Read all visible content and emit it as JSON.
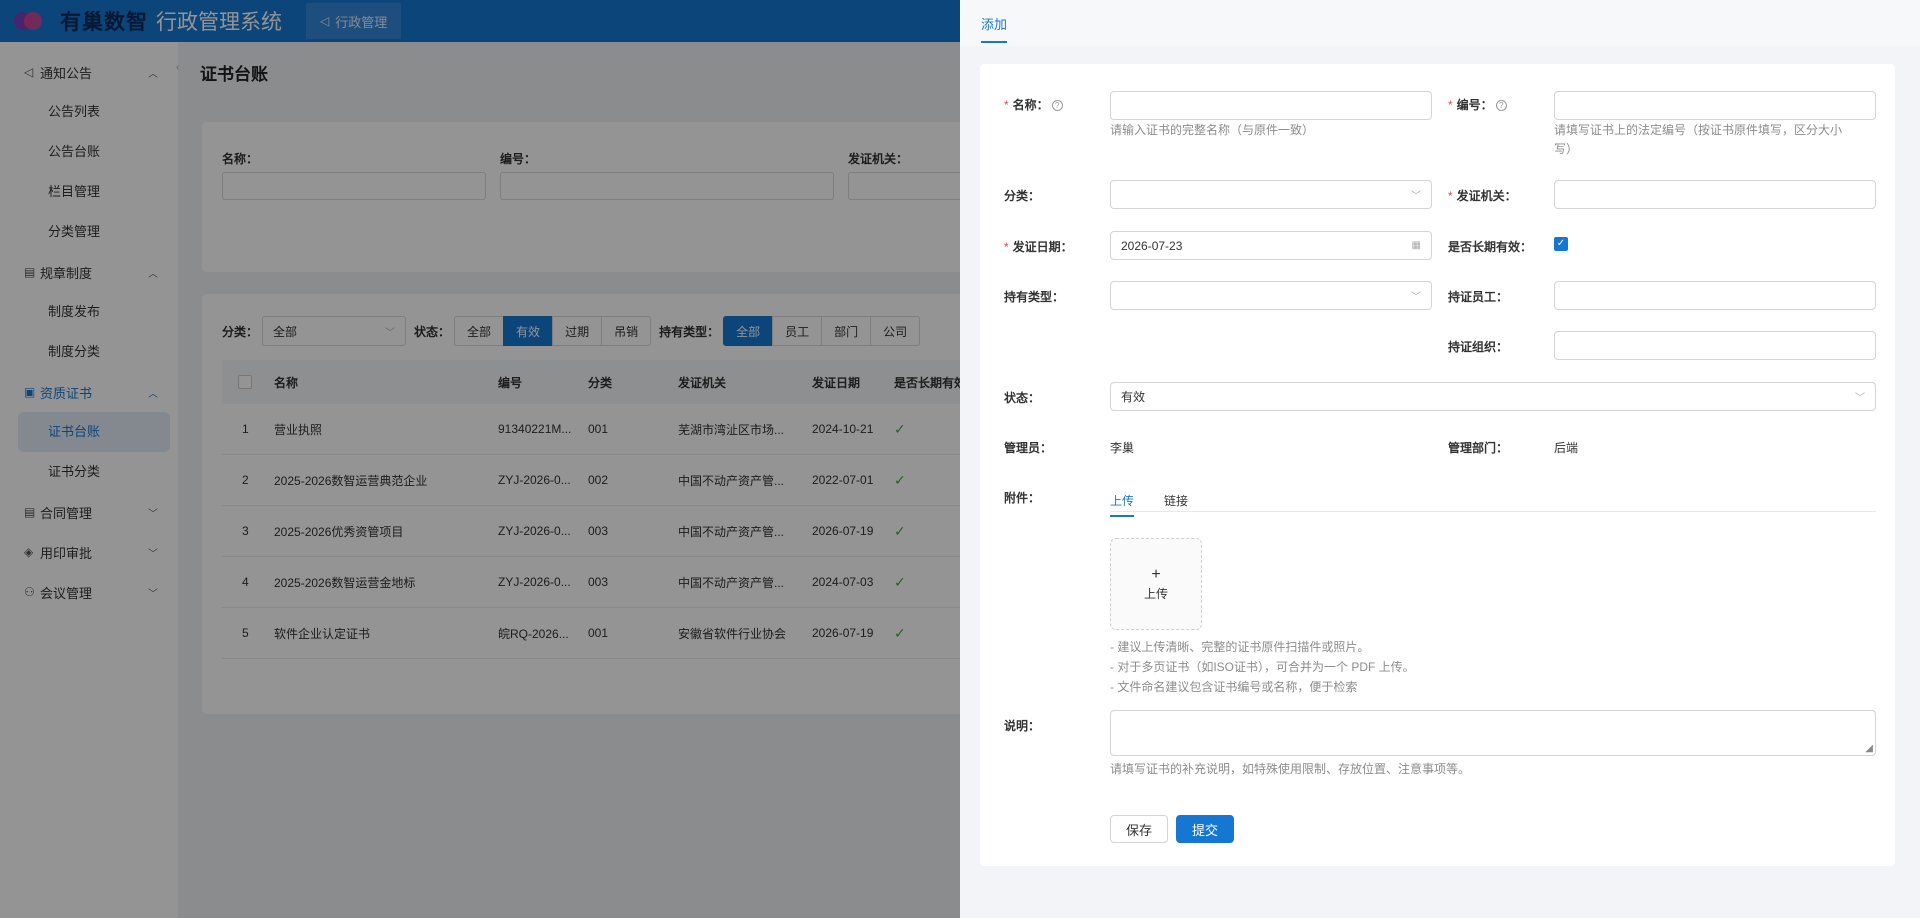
{
  "app": {
    "logo_text": "有巢数智",
    "system_title": "行政管理系统",
    "top_tab": "行政管理"
  },
  "sidebar": {
    "groups": [
      {
        "label": "通知公告",
        "icon": "megaphone-icon",
        "items": [
          "公告列表",
          "公告台账",
          "栏目管理",
          "分类管理"
        ]
      },
      {
        "label": "规章制度",
        "icon": "document-icon",
        "items": [
          "制度发布",
          "制度分类"
        ]
      },
      {
        "label": "资质证书",
        "icon": "certificate-icon",
        "items": [
          "证书台账",
          "证书分类"
        ]
      },
      {
        "label": "合同管理",
        "icon": "contract-icon",
        "items": []
      },
      {
        "label": "用印审批",
        "icon": "seal-icon",
        "items": []
      },
      {
        "label": "会议管理",
        "icon": "people-icon",
        "items": []
      }
    ],
    "active_item": "证书台账"
  },
  "page": {
    "title": "证书台账",
    "filters": {
      "name_label": "名称：",
      "code_label": "编号：",
      "issuer_label": "发证机关："
    },
    "toolbar": {
      "category_label": "分类：",
      "category_value": "全部",
      "status_label": "状态：",
      "status_options": [
        "全部",
        "有效",
        "过期",
        "吊销"
      ],
      "status_selected": "有效",
      "holder_label": "持有类型：",
      "holder_options": [
        "全部",
        "员工",
        "部门",
        "公司"
      ],
      "holder_selected": "全部"
    },
    "table": {
      "columns": [
        "名称",
        "编号",
        "分类",
        "发证机关",
        "发证日期",
        "是否长期有效"
      ],
      "rows": [
        {
          "idx": "1",
          "name": "营业执照",
          "code": "91340221M...",
          "cat": "001",
          "issuer": "芜湖市湾沚区市场...",
          "date": "2024-10-21",
          "longterm": "✓"
        },
        {
          "idx": "2",
          "name": "2025-2026数智运营典范企业",
          "code": "ZYJ-2026-0...",
          "cat": "002",
          "issuer": "中国不动产资产管...",
          "date": "2022-07-01",
          "longterm": "✓"
        },
        {
          "idx": "3",
          "name": "2025-2026优秀资管项目",
          "code": "ZYJ-2026-0...",
          "cat": "003",
          "issuer": "中国不动产资产管...",
          "date": "2026-07-19",
          "longterm": "✓"
        },
        {
          "idx": "4",
          "name": "2025-2026数智运营金地标",
          "code": "ZYJ-2026-0...",
          "cat": "003",
          "issuer": "中国不动产资产管...",
          "date": "2024-07-03",
          "longterm": "✓"
        },
        {
          "idx": "5",
          "name": "软件企业认定证书",
          "code": "皖RQ-2026...",
          "cat": "001",
          "issuer": "安徽省软件行业协会",
          "date": "2026-07-19",
          "longterm": "✓"
        }
      ]
    }
  },
  "drawer": {
    "tab": "添加",
    "form": {
      "name_label": "名称：",
      "name_hint": "请输入证书的完整名称（与原件一致）",
      "code_label": "编号：",
      "code_hint_1": "请填写证书上的法定编号（按证书原件填写，区分大小",
      "code_hint_2": "写）",
      "category_label": "分类：",
      "issuer_label": "发证机关：",
      "issue_date_label": "发证日期：",
      "issue_date_value": "2026-07-23",
      "longterm_label": "是否长期有效：",
      "longterm_checked": true,
      "holder_type_label": "持有类型：",
      "holder_employee_label": "持证员工：",
      "holder_org_label": "持证组织：",
      "status_label": "状态：",
      "status_value": "有效",
      "admin_label": "管理员：",
      "admin_value": "李巢",
      "admin_dept_label": "管理部门：",
      "admin_dept_value": "后端",
      "attachment_label": "附件：",
      "attachment_tabs": [
        "上传",
        "链接"
      ],
      "upload_label": "上传",
      "upload_tips": [
        "- 建议上传清晰、完整的证书原件扫描件或照片。",
        "- 对于多页证书（如ISO证书），可合并为一个 PDF 上传。",
        "- 文件命名建议包含证书编号或名称，便于检索"
      ],
      "description_label": "说明：",
      "description_hint": "请填写证书的补充说明，如特殊使用限制、存放位置、注意事项等。",
      "save_label": "保存",
      "submit_label": "提交"
    }
  },
  "colors": {
    "primary": "#1677d2",
    "required": "#e54545",
    "check": "#3caa3c"
  }
}
